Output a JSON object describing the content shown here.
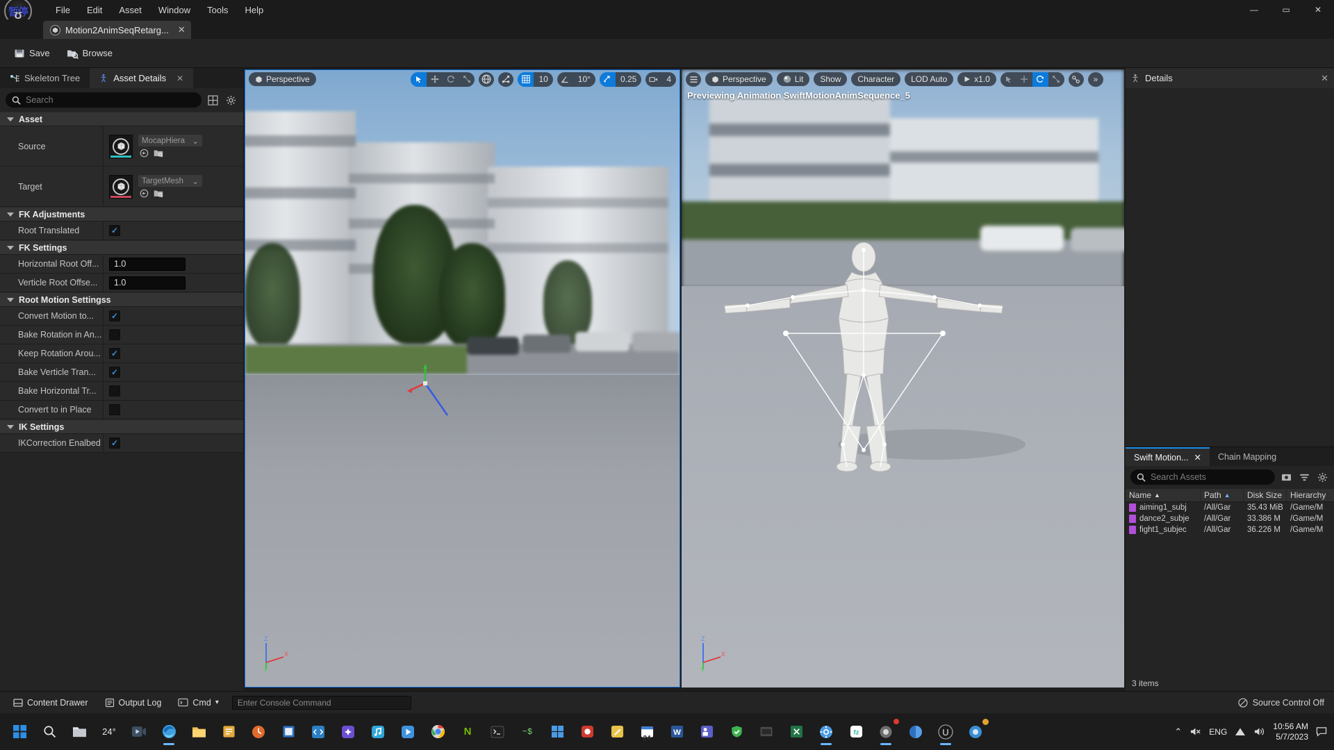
{
  "window": {
    "logo_glyph": "暂停",
    "menus": [
      "File",
      "Edit",
      "Asset",
      "Window",
      "Tools",
      "Help"
    ],
    "controls": {
      "minimize": "—",
      "maximize": "▭",
      "close": "✕"
    },
    "document_tab": {
      "title": "Motion2AnimSeqRetarg...",
      "close": "✕"
    }
  },
  "asset_toolbar": {
    "save": "Save",
    "browse": "Browse"
  },
  "left_panel": {
    "tabs": [
      {
        "label": "Skeleton Tree",
        "active": false,
        "icon": "skeleton-icon"
      },
      {
        "label": "Asset Details",
        "active": true,
        "icon": "details-icon",
        "close": "✕"
      }
    ],
    "search_placeholder": "Search",
    "sections": [
      {
        "title": "Asset",
        "rows": [
          {
            "label": "Source",
            "type": "asset",
            "value": "MocapHiera",
            "accent": "#2ec4c4"
          },
          {
            "label": "Target",
            "type": "asset",
            "value": "TargetMesh",
            "accent": "#c9485a"
          }
        ]
      },
      {
        "title": "FK Adjustments",
        "rows": [
          {
            "label": "Root Translated",
            "type": "check",
            "checked": true
          }
        ]
      },
      {
        "title": "FK Settings",
        "rows": [
          {
            "label": "Horizontal Root Off...",
            "type": "number",
            "value": "1.0"
          },
          {
            "label": "Verticle Root Offse...",
            "type": "number",
            "value": "1.0"
          }
        ]
      },
      {
        "title": "Root Motion Settingss",
        "rows": [
          {
            "label": "Convert Motion to...",
            "type": "check",
            "checked": true
          },
          {
            "label": "Bake Rotation in An...",
            "type": "check",
            "checked": false
          },
          {
            "label": "Keep Rotation Arou...",
            "type": "check",
            "checked": true
          },
          {
            "label": "Bake Verticle Tran...",
            "type": "check",
            "checked": true
          },
          {
            "label": "Bake Horizontal Tr...",
            "type": "check",
            "checked": false
          },
          {
            "label": "Convert to in Place",
            "type": "check",
            "checked": false
          }
        ]
      },
      {
        "title": "IK Settings",
        "rows": [
          {
            "label": "IKCorrection Enalbed",
            "type": "check",
            "checked": true
          }
        ]
      }
    ]
  },
  "viewport_left": {
    "view_mode": "Perspective",
    "grid_snap": "10",
    "angle_snap": "10°",
    "scale_snap": "0.25",
    "camera_speed": "4"
  },
  "viewport_right": {
    "view_mode": "Perspective",
    "lit": "Lit",
    "show": "Show",
    "character": "Character",
    "lod": "LOD Auto",
    "playrate": "x1.0",
    "overlay_text": "Previewing Animation SwiftMotionAnimSequence_5",
    "more": "»"
  },
  "axis_labels": {
    "z": "Z",
    "x": "X",
    "y": "Y"
  },
  "details_panel": {
    "title": "Details",
    "close": "✕"
  },
  "content_browser": {
    "tabs": [
      {
        "label": "Swift Motion...",
        "active": true,
        "close": "✕"
      },
      {
        "label": "Chain Mapping",
        "active": false
      }
    ],
    "search_placeholder": "Search Assets",
    "columns": [
      "Name",
      "Path",
      "Disk Size",
      "Hierarchy"
    ],
    "sort": {
      "name": "▲",
      "path": "▲"
    },
    "rows": [
      {
        "name": "aiming1_subj",
        "path": "/All/Gar",
        "size": "35.43 MiB",
        "hierarchy": "/Game/M"
      },
      {
        "name": "dance2_subje",
        "path": "/All/Gar",
        "size": "33.386 M",
        "hierarchy": "/Game/M"
      },
      {
        "name": "fight1_subjec",
        "path": "/All/Gar",
        "size": "36.226 M",
        "hierarchy": "/Game/M"
      }
    ],
    "footer": "3 items"
  },
  "status_bar": {
    "content_drawer": "Content Drawer",
    "output_log": "Output Log",
    "cmd": "Cmd",
    "console_placeholder": "Enter Console Command",
    "source_control": "Source Control Off"
  },
  "taskbar": {
    "weather": "24°",
    "items": [
      {
        "name": "start-button",
        "glyph": "⊞",
        "color": "#2f8de4"
      },
      {
        "name": "search-button",
        "glyph": "🔍",
        "color": "#cfcfcf"
      },
      {
        "name": "task-view-button",
        "glyph": "❒",
        "color": "#cfcfcf"
      },
      {
        "name": "weather-widget",
        "glyph": "24°",
        "color": "#dcdcdc"
      },
      {
        "name": "video-app",
        "glyph": "▶",
        "color": "#4aa3df"
      },
      {
        "name": "browser-app",
        "glyph": "◍",
        "color": "#4c9ae0"
      },
      {
        "name": "explorer-app",
        "glyph": "🗀",
        "color": "#e8b44a"
      },
      {
        "name": "notes-app",
        "glyph": "▤",
        "color": "#d8a23c"
      },
      {
        "name": "clock-app",
        "glyph": "◷",
        "color": "#e06a2b"
      },
      {
        "name": "editor-app",
        "glyph": "▣",
        "color": "#4c8ddb"
      },
      {
        "name": "code-app",
        "glyph": "⟨⟩",
        "color": "#3aa0e8"
      },
      {
        "name": "chat-app",
        "glyph": "✦",
        "color": "#7b5fe0"
      },
      {
        "name": "music-app",
        "glyph": "♪",
        "color": "#3fb1e5"
      },
      {
        "name": "play-app",
        "glyph": "▶",
        "color": "#49a6e8"
      },
      {
        "name": "chrome-app",
        "glyph": "◎",
        "color": "#4f9df0"
      },
      {
        "name": "nvidia-app",
        "glyph": "N",
        "color": "#64b51f"
      },
      {
        "name": "terminal-app",
        "glyph": "▮",
        "color": "#2d2d2d"
      },
      {
        "name": "mongo-app",
        "glyph": "~$",
        "color": "#30a24a"
      },
      {
        "name": "store-app",
        "glyph": "⊞",
        "color": "#4b9ae6"
      },
      {
        "name": "red-app",
        "glyph": "●",
        "color": "#d03a2f"
      },
      {
        "name": "note-app",
        "glyph": "✎",
        "color": "#e8c34a"
      },
      {
        "name": "calendar-app",
        "glyph": "24",
        "color": "#3a7fd5"
      },
      {
        "name": "word-app",
        "glyph": "W",
        "color": "#2b579a"
      },
      {
        "name": "teams-app",
        "glyph": "▦",
        "color": "#5b5fc7"
      },
      {
        "name": "security-app",
        "glyph": "✓",
        "color": "#3fb34f"
      },
      {
        "name": "console-app",
        "glyph": "▭",
        "color": "#4a4a4a"
      },
      {
        "name": "excel-app",
        "glyph": "▤",
        "color": "#217346"
      },
      {
        "name": "settings-app",
        "glyph": "⚙",
        "color": "#4a9ae2"
      },
      {
        "name": "filmora-app",
        "glyph": "fz",
        "color": "#2bb5a0"
      },
      {
        "name": "recorder-app",
        "glyph": "◉",
        "color": "#9a9a9a"
      },
      {
        "name": "chrome2-app",
        "glyph": "◐",
        "color": "#58a0e8"
      },
      {
        "name": "unreal-app",
        "glyph": "U",
        "color": "#cfcfcf"
      },
      {
        "name": "misc-app",
        "glyph": "◍",
        "color": "#3a8fd6"
      }
    ],
    "tray": {
      "chevron": "⌃",
      "mute": "🔇",
      "lang": "ENG",
      "wifi": "▲",
      "volume": "🔊",
      "time": "10:56 AM",
      "date": "5/7/2023",
      "notifications": "🗨"
    }
  }
}
